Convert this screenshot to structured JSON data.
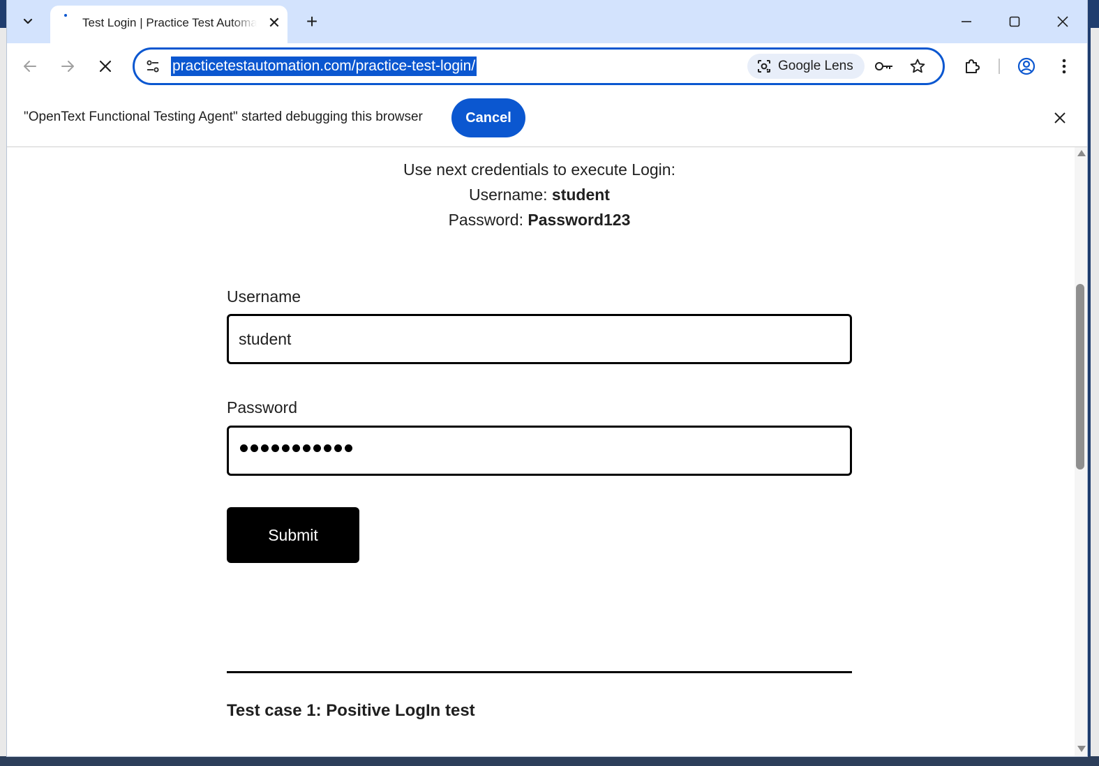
{
  "tab": {
    "title": "Test Login | Practice Test Automation",
    "close": "✕",
    "new_tab": "+"
  },
  "toolbar": {
    "url": "practicetestautomation.com/practice-test-login/",
    "lens_label": "Google Lens"
  },
  "infobar": {
    "message": "\"OpenText Functional Testing Agent\" started debugging this browser",
    "cancel_label": "Cancel"
  },
  "page": {
    "intro": "Use next credentials to execute Login:",
    "username_prefix": "Username: ",
    "username_value": "student",
    "password_prefix": "Password: ",
    "password_value": "Password123",
    "username_label": "Username",
    "username_input_value": "student",
    "password_label": "Password",
    "password_masked_length": 11,
    "submit_label": "Submit",
    "test_case_heading": "Test case 1: Positive LogIn test"
  },
  "icons": {
    "tab_list": "chevron-down-icon",
    "back": "arrow-left-icon",
    "forward": "arrow-right-icon",
    "stop": "close-icon",
    "site_info": "tune-icon",
    "lens": "camera-search-icon",
    "key": "key-icon",
    "bookmark": "star-icon",
    "extensions": "puzzle-icon",
    "profile": "account-icon",
    "menu": "more-vert-icon"
  },
  "colors": {
    "accent": "#0b57d0",
    "tab_strip": "#d3e3fd",
    "submit_bg": "#000000"
  }
}
